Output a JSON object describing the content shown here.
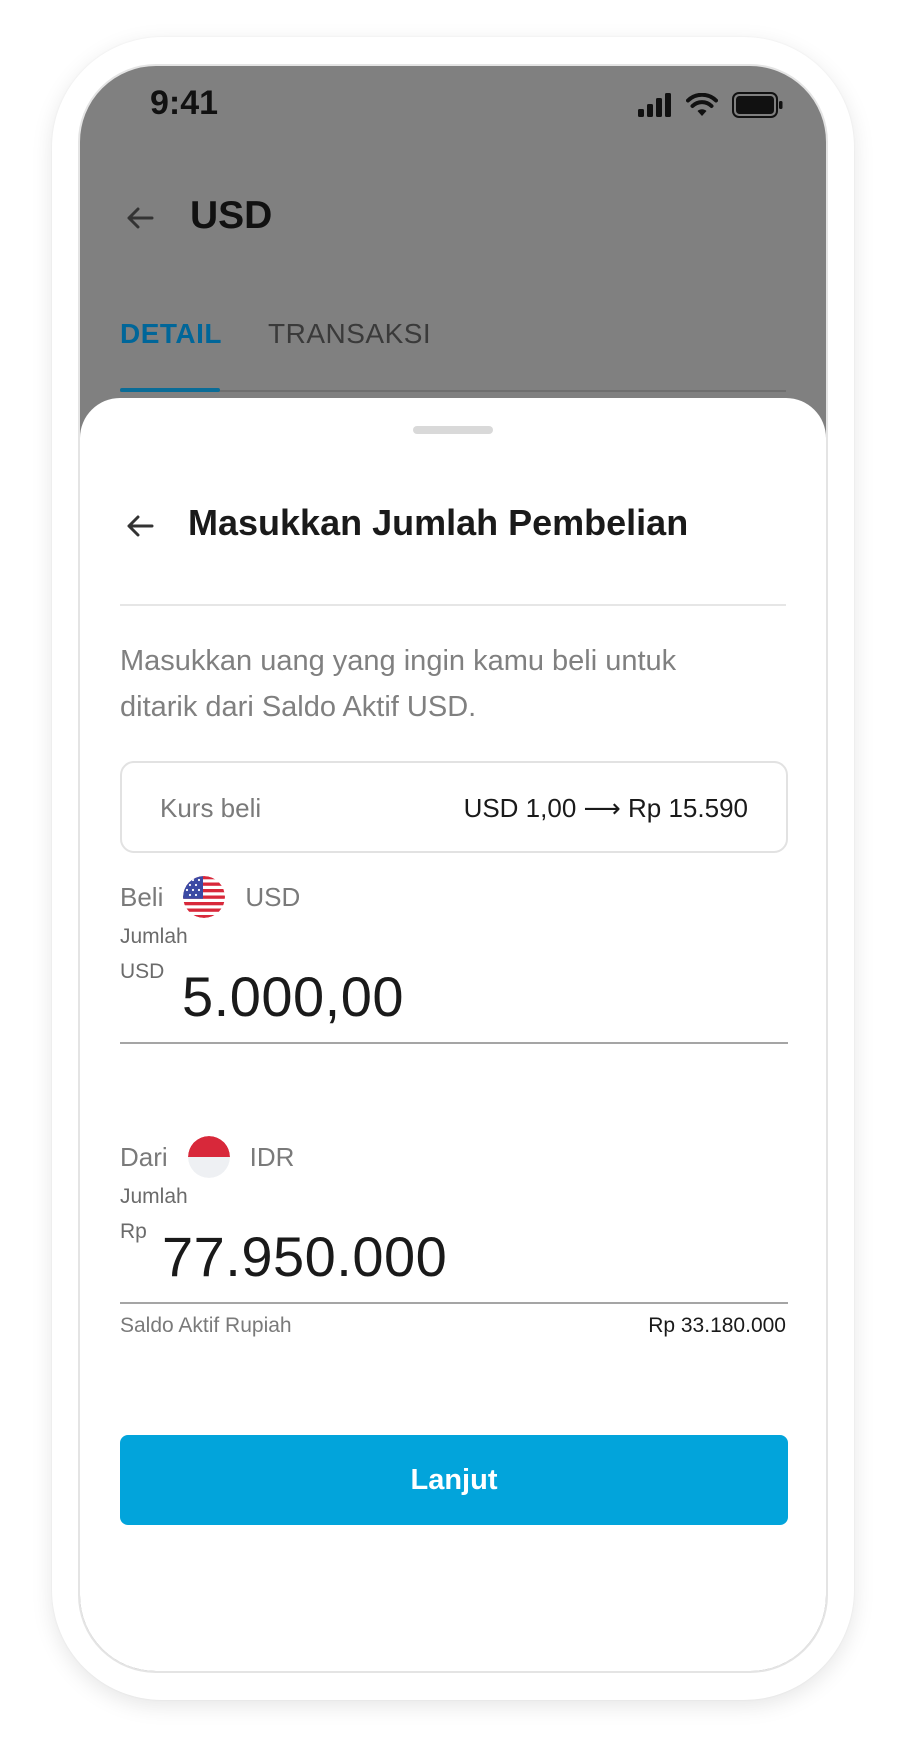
{
  "status_bar": {
    "time": "9:41"
  },
  "header": {
    "title": "USD"
  },
  "tabs": [
    {
      "label": "DETAIL",
      "active": true
    },
    {
      "label": "TRANSAKSI",
      "active": false
    }
  ],
  "sheet": {
    "title": "Masukkan Jumlah Pembelian",
    "description": "Masukkan uang yang ingin kamu beli untuk ditarik dari Saldo Aktif USD.",
    "rate": {
      "label": "Kurs beli",
      "value": "USD 1,00 ⟶ Rp 15.590"
    },
    "buy": {
      "label": "Beli",
      "currency": "USD",
      "flag_icon": "us-flag-icon",
      "field_label": "Jumlah",
      "prefix": "USD",
      "amount": "5.000,00"
    },
    "from": {
      "label": "Dari",
      "currency": "IDR",
      "flag_icon": "indonesia-flag-icon",
      "field_label": "Jumlah",
      "prefix": "Rp",
      "amount": "77.950.000"
    },
    "balance": {
      "label": "Saldo Aktif Rupiah",
      "value": "Rp 33.180.000"
    },
    "cta_label": "Lanjut"
  },
  "colors": {
    "accent": "#02a4db",
    "tab_active": "#006699",
    "overlay": "#808080"
  }
}
